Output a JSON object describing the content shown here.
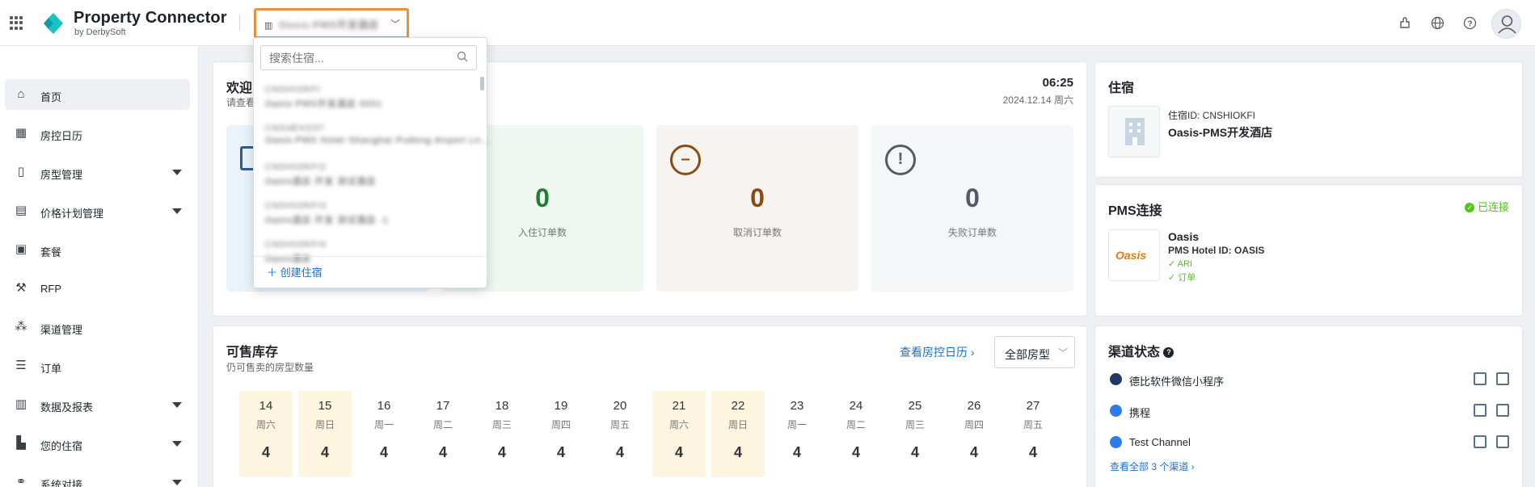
{
  "app": {
    "title": "Property Connector",
    "subtitle": "by DerbySoft",
    "hotel_selector_value": "Oasis-PMS开发酒店",
    "accent": "#1a6fcf",
    "annotation_color": "#e8913d"
  },
  "top_icons": [
    "extension-icon",
    "globe-icon",
    "help-icon",
    "user-avatar"
  ],
  "sidebar": {
    "items": [
      {
        "label": "首页",
        "icon": "home-icon",
        "active": true,
        "expandable": false
      },
      {
        "label": "房控日历",
        "icon": "calendar-icon",
        "active": false,
        "expandable": false
      },
      {
        "label": "房型管理",
        "icon": "door-icon",
        "active": false,
        "expandable": true
      },
      {
        "label": "价格计划管理",
        "icon": "price-plan-icon",
        "active": false,
        "expandable": true
      },
      {
        "label": "套餐",
        "icon": "package-icon",
        "active": false,
        "expandable": false
      },
      {
        "label": "RFP",
        "icon": "gavel-icon",
        "active": false,
        "expandable": false
      },
      {
        "label": "渠道管理",
        "icon": "channel-icon",
        "active": false,
        "expandable": false
      },
      {
        "label": "订单",
        "icon": "order-icon",
        "active": false,
        "expandable": false
      },
      {
        "label": "数据及报表",
        "icon": "chart-icon",
        "active": false,
        "expandable": true
      },
      {
        "label": "您的住宿",
        "icon": "building-icon",
        "active": false,
        "expandable": true
      },
      {
        "label": "系统对接",
        "icon": "link-icon",
        "active": false,
        "expandable": true
      }
    ]
  },
  "dropdown": {
    "search_placeholder": "搜索住宿...",
    "items": [
      {
        "line1": "CNSHIOKFI",
        "line2": "Oasis-PMS开发酒店 0001"
      },
      {
        "line1": "CNS4EXO37",
        "line2": "Oasis-PMS Hotel Shanghai Pudong Airport Ln..."
      },
      {
        "line1": "CNSHIOKFI2",
        "line2": "Oasis酒店 开发 测试酒店"
      },
      {
        "line1": "CNSHIOKFI3",
        "line2": "Oasis酒店 开发 测试酒店 -1"
      },
      {
        "line1": "CNSHIOKFI4",
        "line2": "Oasis酒店"
      }
    ],
    "create_label": "创建住宿"
  },
  "welcome": {
    "title": "欢迎",
    "subtitle": "请查看",
    "time": "06:25",
    "date": "2024.12.14 周六",
    "stats": [
      {
        "value": "0",
        "label": "入住订单数",
        "color": "#1e7e34",
        "bg": "#eef7f0"
      },
      {
        "value": "0",
        "label": "取消订单数",
        "color": "#8a4b10",
        "bg": "#f6f3f1",
        "icon": "minus-circle-icon"
      },
      {
        "value": "0",
        "label": "失败订单数",
        "color": "#555b66",
        "bg": "#f5f6f7",
        "icon": "exclamation-circle-icon"
      }
    ]
  },
  "stay": {
    "title": "住宿",
    "id_line": "住宿ID: CNSHIOKFI",
    "name": "Oasis-PMS开发酒店"
  },
  "pms": {
    "title": "PMS连接",
    "status": "已连接",
    "status_color": "#52c41a",
    "name": "Oasis",
    "hotel_id": "PMS Hotel ID: OASIS",
    "features": [
      "ARI",
      "订单"
    ],
    "logo_text": "Oasis"
  },
  "inventory": {
    "title": "可售库存",
    "subtitle": "仍可售卖的房型数量",
    "link": "查看房控日历",
    "filter": "全部房型",
    "days": [
      {
        "num": "14",
        "week": "周六",
        "value": "4",
        "weekend": true
      },
      {
        "num": "15",
        "week": "周日",
        "value": "4",
        "weekend": true
      },
      {
        "num": "16",
        "week": "周一",
        "value": "4",
        "weekend": false
      },
      {
        "num": "17",
        "week": "周二",
        "value": "4",
        "weekend": false
      },
      {
        "num": "18",
        "week": "周三",
        "value": "4",
        "weekend": false
      },
      {
        "num": "19",
        "week": "周四",
        "value": "4",
        "weekend": false
      },
      {
        "num": "20",
        "week": "周五",
        "value": "4",
        "weekend": false
      },
      {
        "num": "21",
        "week": "周六",
        "value": "4",
        "weekend": true
      },
      {
        "num": "22",
        "week": "周日",
        "value": "4",
        "weekend": true
      },
      {
        "num": "23",
        "week": "周一",
        "value": "4",
        "weekend": false
      },
      {
        "num": "24",
        "week": "周二",
        "value": "4",
        "weekend": false
      },
      {
        "num": "25",
        "week": "周三",
        "value": "4",
        "weekend": false
      },
      {
        "num": "26",
        "week": "周四",
        "value": "4",
        "weekend": false
      },
      {
        "num": "27",
        "week": "周五",
        "value": "4",
        "weekend": false
      }
    ]
  },
  "channels": {
    "title": "渠道状态",
    "items": [
      {
        "name": "德比软件微信小程序",
        "icon_color": "#1f3a64"
      },
      {
        "name": "携程",
        "icon_color": "#2b7de9"
      },
      {
        "name": "Test Channel",
        "icon_color": "#2b7de9"
      }
    ],
    "view_all": "查看全部 3 个渠道"
  }
}
